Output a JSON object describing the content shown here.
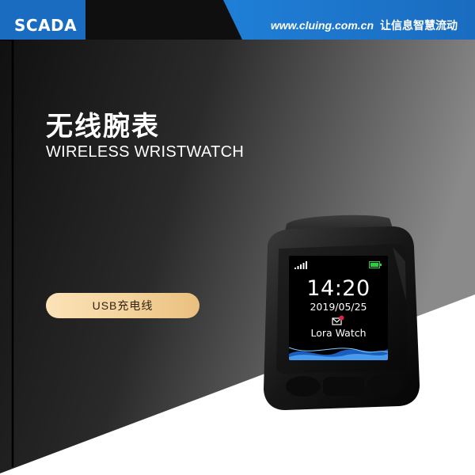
{
  "header": {
    "brand": "SCADA",
    "website": "www.cluing.com.cn",
    "slogan": "让信息智慧流动"
  },
  "product": {
    "title_cn": "无线腕表",
    "title_en": "WIRELESS WRISTWATCH",
    "accessory_label": "USB充电线"
  },
  "watch_screen": {
    "time": "14:20",
    "date": "2019/05/25",
    "app_name": "Lora Watch",
    "icons": [
      "signal-icon",
      "battery-icon",
      "mail-icon"
    ]
  },
  "colors": {
    "header_blue": "#1d79cf",
    "dark_bg": "#1b1b1b",
    "pill_gold": "#f4d29b",
    "battery_green": "#2ecc40",
    "mail_badge": "#e0204a",
    "wave_blue": "#2a8cf0"
  }
}
